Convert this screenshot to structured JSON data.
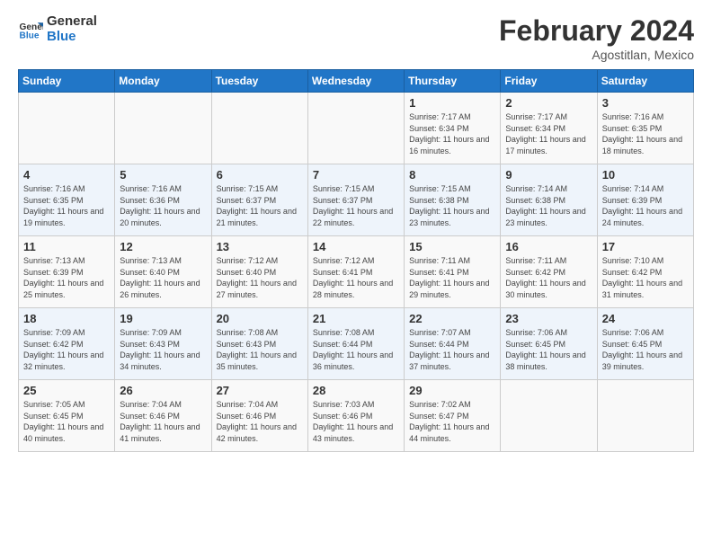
{
  "header": {
    "logo_line1": "General",
    "logo_line2": "Blue",
    "month_title": "February 2024",
    "location": "Agostitlan, Mexico"
  },
  "days_of_week": [
    "Sunday",
    "Monday",
    "Tuesday",
    "Wednesday",
    "Thursday",
    "Friday",
    "Saturday"
  ],
  "weeks": [
    [
      {
        "date": "",
        "info": ""
      },
      {
        "date": "",
        "info": ""
      },
      {
        "date": "",
        "info": ""
      },
      {
        "date": "",
        "info": ""
      },
      {
        "date": "1",
        "info": "Sunrise: 7:17 AM\nSunset: 6:34 PM\nDaylight: 11 hours and 16 minutes."
      },
      {
        "date": "2",
        "info": "Sunrise: 7:17 AM\nSunset: 6:34 PM\nDaylight: 11 hours and 17 minutes."
      },
      {
        "date": "3",
        "info": "Sunrise: 7:16 AM\nSunset: 6:35 PM\nDaylight: 11 hours and 18 minutes."
      }
    ],
    [
      {
        "date": "4",
        "info": "Sunrise: 7:16 AM\nSunset: 6:35 PM\nDaylight: 11 hours and 19 minutes."
      },
      {
        "date": "5",
        "info": "Sunrise: 7:16 AM\nSunset: 6:36 PM\nDaylight: 11 hours and 20 minutes."
      },
      {
        "date": "6",
        "info": "Sunrise: 7:15 AM\nSunset: 6:37 PM\nDaylight: 11 hours and 21 minutes."
      },
      {
        "date": "7",
        "info": "Sunrise: 7:15 AM\nSunset: 6:37 PM\nDaylight: 11 hours and 22 minutes."
      },
      {
        "date": "8",
        "info": "Sunrise: 7:15 AM\nSunset: 6:38 PM\nDaylight: 11 hours and 23 minutes."
      },
      {
        "date": "9",
        "info": "Sunrise: 7:14 AM\nSunset: 6:38 PM\nDaylight: 11 hours and 23 minutes."
      },
      {
        "date": "10",
        "info": "Sunrise: 7:14 AM\nSunset: 6:39 PM\nDaylight: 11 hours and 24 minutes."
      }
    ],
    [
      {
        "date": "11",
        "info": "Sunrise: 7:13 AM\nSunset: 6:39 PM\nDaylight: 11 hours and 25 minutes."
      },
      {
        "date": "12",
        "info": "Sunrise: 7:13 AM\nSunset: 6:40 PM\nDaylight: 11 hours and 26 minutes."
      },
      {
        "date": "13",
        "info": "Sunrise: 7:12 AM\nSunset: 6:40 PM\nDaylight: 11 hours and 27 minutes."
      },
      {
        "date": "14",
        "info": "Sunrise: 7:12 AM\nSunset: 6:41 PM\nDaylight: 11 hours and 28 minutes."
      },
      {
        "date": "15",
        "info": "Sunrise: 7:11 AM\nSunset: 6:41 PM\nDaylight: 11 hours and 29 minutes."
      },
      {
        "date": "16",
        "info": "Sunrise: 7:11 AM\nSunset: 6:42 PM\nDaylight: 11 hours and 30 minutes."
      },
      {
        "date": "17",
        "info": "Sunrise: 7:10 AM\nSunset: 6:42 PM\nDaylight: 11 hours and 31 minutes."
      }
    ],
    [
      {
        "date": "18",
        "info": "Sunrise: 7:09 AM\nSunset: 6:42 PM\nDaylight: 11 hours and 32 minutes."
      },
      {
        "date": "19",
        "info": "Sunrise: 7:09 AM\nSunset: 6:43 PM\nDaylight: 11 hours and 34 minutes."
      },
      {
        "date": "20",
        "info": "Sunrise: 7:08 AM\nSunset: 6:43 PM\nDaylight: 11 hours and 35 minutes."
      },
      {
        "date": "21",
        "info": "Sunrise: 7:08 AM\nSunset: 6:44 PM\nDaylight: 11 hours and 36 minutes."
      },
      {
        "date": "22",
        "info": "Sunrise: 7:07 AM\nSunset: 6:44 PM\nDaylight: 11 hours and 37 minutes."
      },
      {
        "date": "23",
        "info": "Sunrise: 7:06 AM\nSunset: 6:45 PM\nDaylight: 11 hours and 38 minutes."
      },
      {
        "date": "24",
        "info": "Sunrise: 7:06 AM\nSunset: 6:45 PM\nDaylight: 11 hours and 39 minutes."
      }
    ],
    [
      {
        "date": "25",
        "info": "Sunrise: 7:05 AM\nSunset: 6:45 PM\nDaylight: 11 hours and 40 minutes."
      },
      {
        "date": "26",
        "info": "Sunrise: 7:04 AM\nSunset: 6:46 PM\nDaylight: 11 hours and 41 minutes."
      },
      {
        "date": "27",
        "info": "Sunrise: 7:04 AM\nSunset: 6:46 PM\nDaylight: 11 hours and 42 minutes."
      },
      {
        "date": "28",
        "info": "Sunrise: 7:03 AM\nSunset: 6:46 PM\nDaylight: 11 hours and 43 minutes."
      },
      {
        "date": "29",
        "info": "Sunrise: 7:02 AM\nSunset: 6:47 PM\nDaylight: 11 hours and 44 minutes."
      },
      {
        "date": "",
        "info": ""
      },
      {
        "date": "",
        "info": ""
      }
    ]
  ]
}
